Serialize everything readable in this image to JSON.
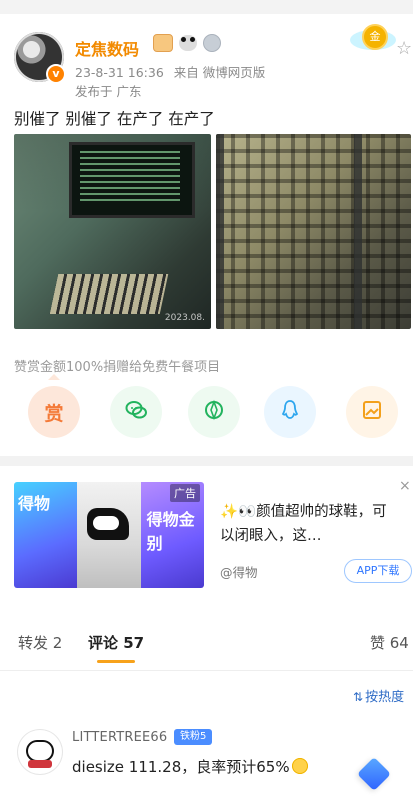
{
  "post": {
    "author": "定焦数码",
    "author_avatar_badge": "v",
    "timestamp": "23-8-31 16:36",
    "via": "来自 微博网页版",
    "location": "发布于 广东",
    "text": "别催了 别催了 在产了 在产了",
    "photo_watermark": "2023.08.",
    "reward_note": "赞赏金额100%捐赠给免费午餐项目",
    "reward_label": "赏",
    "medal_label": "金"
  },
  "share": {
    "icons": [
      "reward-icon",
      "wechat-icon",
      "moments-icon",
      "qq-icon",
      "image-share-icon"
    ]
  },
  "ad": {
    "tag": "广告",
    "brand": "得物",
    "brand2": "得物金别",
    "text": "✨👀颜值超帅的球鞋，可以闭眼入，这…",
    "source": "@得物",
    "cta": "APP下载",
    "close": "×"
  },
  "tabs": {
    "repost": "转发 2",
    "comment": "评论 57",
    "like": "赞 64"
  },
  "sort": {
    "icon": "⇅",
    "label": "按热度"
  },
  "comment": {
    "user": "LITTERTREE66",
    "badge": "铁粉5",
    "text": "diesize 111.28，良率预计65%"
  },
  "colors": {
    "accent_orange": "#f28a00",
    "tab_underline": "#f7a21b",
    "link_blue": "#2f6cc6"
  }
}
